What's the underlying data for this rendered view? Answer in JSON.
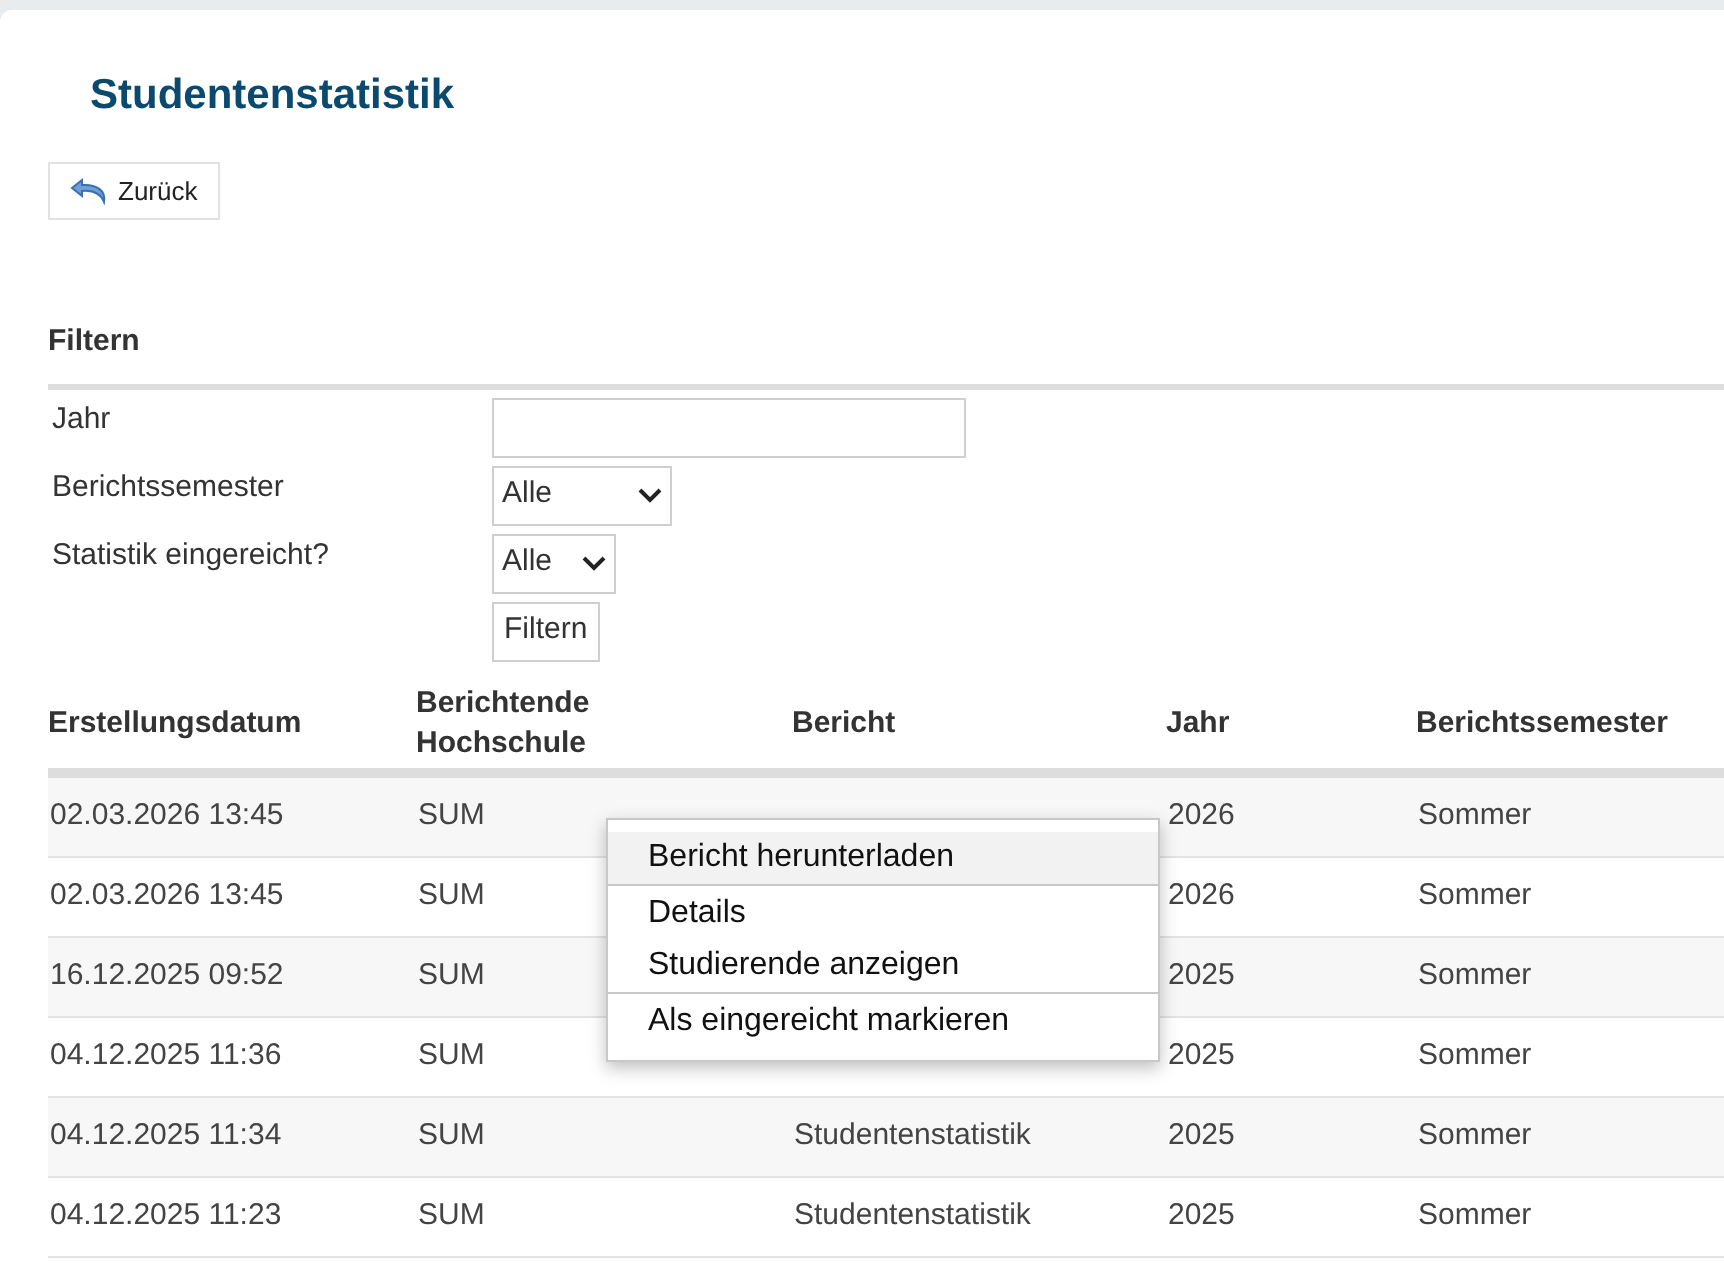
{
  "title": "Studentenstatistik",
  "back_button": {
    "label": "Zurück"
  },
  "filter": {
    "heading": "Filtern",
    "fields": [
      {
        "kind": "text",
        "label": "Jahr"
      },
      {
        "kind": "select",
        "label": "Berichtssemester",
        "value": "Alle"
      },
      {
        "kind": "select",
        "label": "Statistik eingereicht?",
        "value": "Alle"
      }
    ],
    "submit": "Filtern"
  },
  "table": {
    "columns": [
      "Erstellungsdatum",
      "Berichtende Hochschule",
      "Bericht",
      "Jahr",
      "Berichtssemester"
    ],
    "rows": [
      {
        "cells": [
          "02.03.2026 13:45",
          "SUM",
          "",
          "2026",
          "Sommer"
        ]
      },
      {
        "cells": [
          "02.03.2026 13:45",
          "SUM",
          "",
          "2026",
          "Sommer"
        ]
      },
      {
        "cells": [
          "16.12.2025 09:52",
          "SUM",
          "",
          "2025",
          "Sommer"
        ]
      },
      {
        "cells": [
          "04.12.2025 11:36",
          "SUM",
          "",
          "2025",
          "Sommer"
        ]
      },
      {
        "cells": [
          "04.12.2025 11:34",
          "SUM",
          "Studentenstatistik",
          "2025",
          "Sommer"
        ]
      },
      {
        "cells": [
          "04.12.2025 11:23",
          "SUM",
          "Studentenstatistik",
          "2025",
          "Sommer"
        ]
      }
    ]
  },
  "context_menu": {
    "items": [
      {
        "label": "Bericht herunterladen",
        "selected": true,
        "divider_below": true
      },
      {
        "label": "Details",
        "selected": false,
        "divider_below": false
      },
      {
        "label": "Studierende anzeigen",
        "selected": false,
        "divider_below": true
      },
      {
        "label": "Als eingereicht markieren",
        "selected": false,
        "divider_below": false
      }
    ]
  }
}
